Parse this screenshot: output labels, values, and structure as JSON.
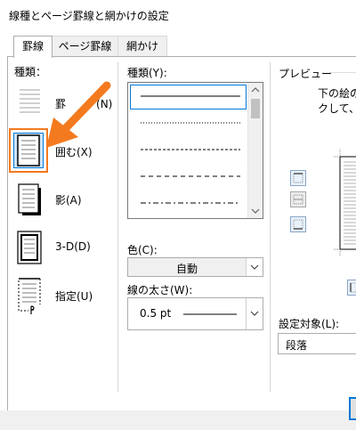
{
  "dialog": {
    "title": "線種とページ罫線と網かけの設定"
  },
  "tabs": [
    {
      "label": "罫線"
    },
    {
      "label": "ページ罫線"
    },
    {
      "label": "網かけ"
    }
  ],
  "setting": {
    "label": "種類：",
    "options": [
      {
        "label": "罫線(N)",
        "prefix": "罫",
        "key": "(N)"
      },
      {
        "label": "囲む(X)",
        "prefix": "囲む",
        "key": "(X)"
      },
      {
        "label": "影(A)",
        "prefix": "影",
        "key": "(A)"
      },
      {
        "label": "3-D(D)",
        "prefix": "3-D",
        "key": "(D)"
      },
      {
        "label": "指定(U)",
        "prefix": "指定",
        "key": "(U)"
      }
    ],
    "selected": "囲む(X)"
  },
  "style": {
    "label": "種類(Y):",
    "lines": [
      "solid",
      "dotted",
      "dashed-small",
      "dashed",
      "dash-dot"
    ]
  },
  "color": {
    "label": "色(C):",
    "value": "自動"
  },
  "width": {
    "label": "線の太さ(W):",
    "value": "0.5 pt"
  },
  "preview": {
    "label": "プレビュー",
    "instruction_line1": "下の絵の",
    "instruction_line2": "クして、"
  },
  "apply_to": {
    "label": "設定対象(L):",
    "value": "段落"
  },
  "colors": {
    "accent_arrow": "#f47a1f",
    "selection_blue": "#0078d7"
  }
}
